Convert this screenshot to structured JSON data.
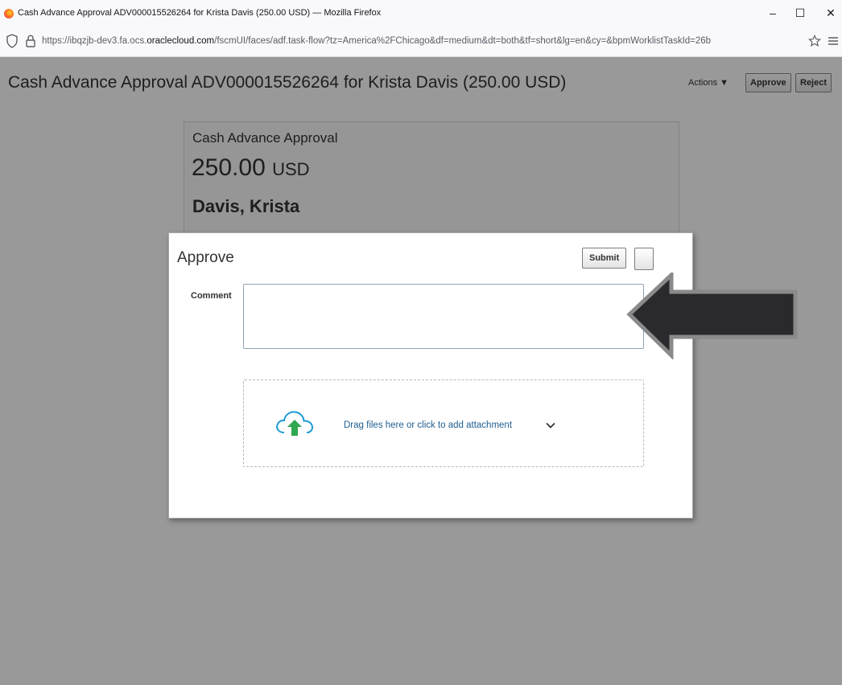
{
  "window": {
    "title": "Cash Advance Approval ADV000015526264 for Krista Davis (250.00 USD) — Mozilla Firefox",
    "minimize": "–",
    "maximize": "☐",
    "close": "✕"
  },
  "urlbar": {
    "url_prefix": "https://ibqzjb-dev3.fa.ocs.",
    "url_domain": "oraclecloud.com",
    "url_suffix": "/fscmUI/faces/adf.task-flow?tz=America%2FChicago&df=medium&dt=both&tf=short&lg=en&cy=&bpmWorklistTaskId=26b"
  },
  "page": {
    "title": "Cash Advance Approval ADV000015526264 for Krista Davis (250.00 USD)",
    "actions_label": "Actions ▼",
    "approve_label": "Approve",
    "reject_label": "Reject"
  },
  "card": {
    "title": "Cash Advance Approval",
    "amount": "250.00",
    "currency": "USD",
    "name": "Davis, Krista"
  },
  "dialog": {
    "title": "Approve",
    "submit_label": "Submit",
    "comment_label": "Comment",
    "comment_value": "",
    "drop_text": "Drag files here or click to add attachment"
  },
  "colors": {
    "link": "#1f5e92",
    "upload_green": "#2fa84f",
    "upload_cloud": "#1e9bd7",
    "arrow_fill": "#2a2a2e"
  },
  "icons": [
    "firefox-logo-icon",
    "shield-icon",
    "lock-icon",
    "star-icon",
    "menu-icon",
    "cloud-upload-icon",
    "chevron-down-icon",
    "arrow-annotation"
  ]
}
